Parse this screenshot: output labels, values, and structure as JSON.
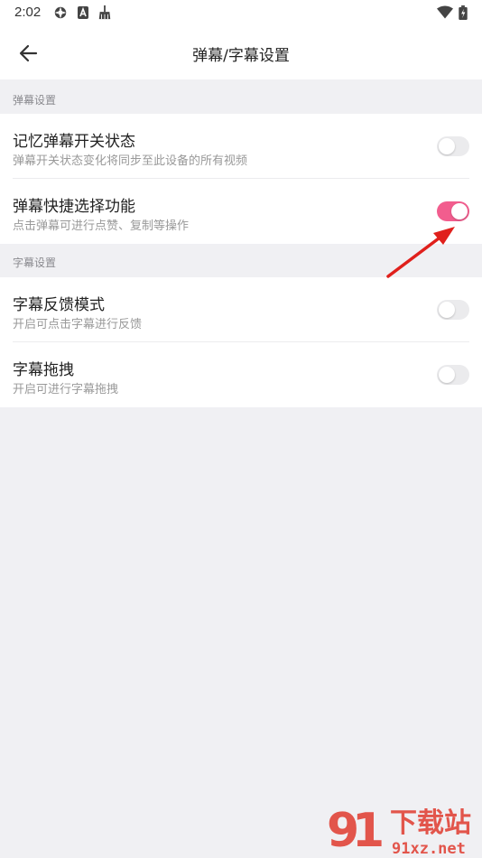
{
  "status_bar": {
    "time": "2:02",
    "icons": [
      "settings-wheel-icon",
      "a-badge-icon",
      "broom-icon"
    ],
    "right_icons": [
      "wifi-icon",
      "battery-icon"
    ]
  },
  "app_bar": {
    "back_icon": "arrow-left-icon",
    "title": "弹幕/字幕设置"
  },
  "sections": [
    {
      "header": "弹幕设置",
      "items": [
        {
          "title": "记忆弹幕开关状态",
          "subtitle": "弹幕开关状态变化将同步至此设备的所有视频",
          "enabled": false
        },
        {
          "title": "弹幕快捷选择功能",
          "subtitle": "点击弹幕可进行点赞、复制等操作",
          "enabled": true
        }
      ]
    },
    {
      "header": "字幕设置",
      "items": [
        {
          "title": "字幕反馈模式",
          "subtitle": "开启可点击字幕进行反馈",
          "enabled": false
        },
        {
          "title": "字幕拖拽",
          "subtitle": "开启可进行字幕拖拽",
          "enabled": false
        }
      ]
    }
  ],
  "colors": {
    "toggle_on": "#f25d8e",
    "toggle_off": "#ebebed",
    "annotation_arrow": "#e0201c"
  },
  "watermark": {
    "text_main": "下载站",
    "text_sub": "91xz.net"
  }
}
